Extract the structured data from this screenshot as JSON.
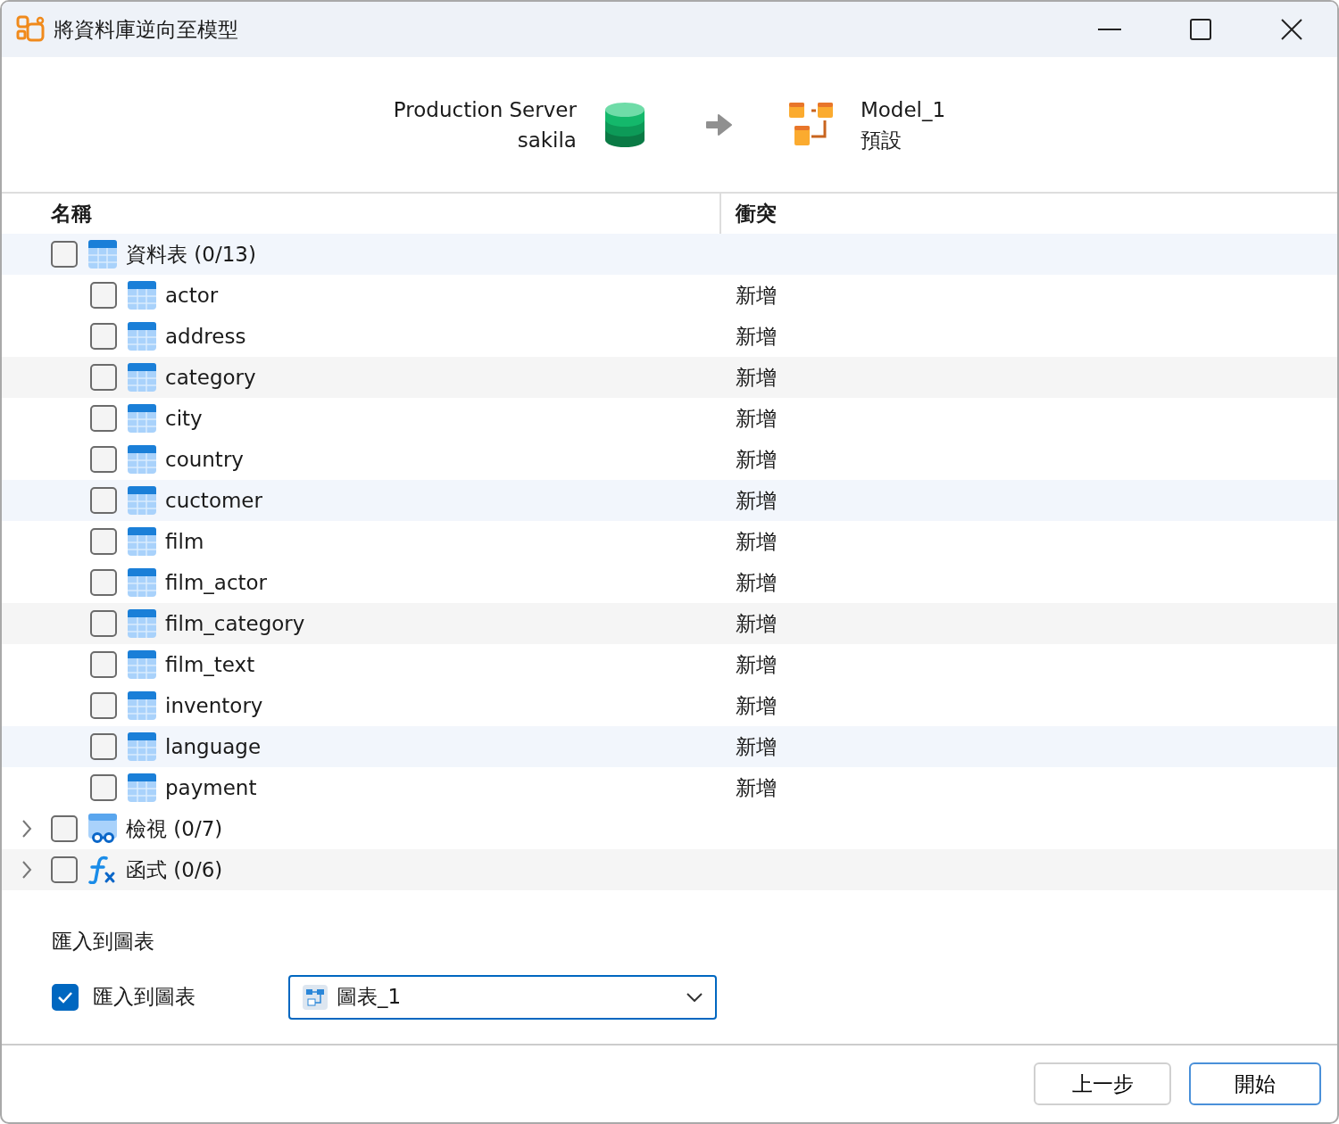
{
  "window": {
    "title": "將資料庫逆向至模型"
  },
  "source": {
    "server": "Production Server",
    "database": "sakila"
  },
  "target": {
    "model": "Model_1",
    "schema": "預設"
  },
  "tree": {
    "columns": [
      "名稱",
      "衝突"
    ],
    "items": [
      {
        "kind": "tables",
        "label": "資料表 (0/13)",
        "checked": false,
        "expanded": true,
        "children": [
          {
            "label": "actor",
            "conflict": "新增",
            "checked": false
          },
          {
            "label": "address",
            "conflict": "新增",
            "checked": false
          },
          {
            "label": "category",
            "conflict": "新增",
            "checked": false
          },
          {
            "label": "city",
            "conflict": "新增",
            "checked": false
          },
          {
            "label": "country",
            "conflict": "新增",
            "checked": false
          },
          {
            "label": "cuctomer",
            "conflict": "新增",
            "checked": false
          },
          {
            "label": "film",
            "conflict": "新增",
            "checked": false
          },
          {
            "label": "film_actor",
            "conflict": "新增",
            "checked": false
          },
          {
            "label": "film_category",
            "conflict": "新增",
            "checked": false
          },
          {
            "label": "film_text",
            "conflict": "新增",
            "checked": false
          },
          {
            "label": "inventory",
            "conflict": "新增",
            "checked": false
          },
          {
            "label": "language",
            "conflict": "新增",
            "checked": false
          },
          {
            "label": "payment",
            "conflict": "新增",
            "checked": false
          }
        ]
      },
      {
        "kind": "views",
        "label": "檢視 (0/7)",
        "checked": false,
        "expanded": false
      },
      {
        "kind": "functions",
        "label": "函式 (0/6)",
        "checked": false,
        "expanded": false
      }
    ]
  },
  "import": {
    "section_title": "匯入到圖表",
    "checkbox_label": "匯入到圖表",
    "checked": true,
    "diagram": "圖表_1"
  },
  "buttons": [
    {
      "label": "上一步",
      "primary": false
    },
    {
      "label": "開始",
      "primary": true
    }
  ]
}
